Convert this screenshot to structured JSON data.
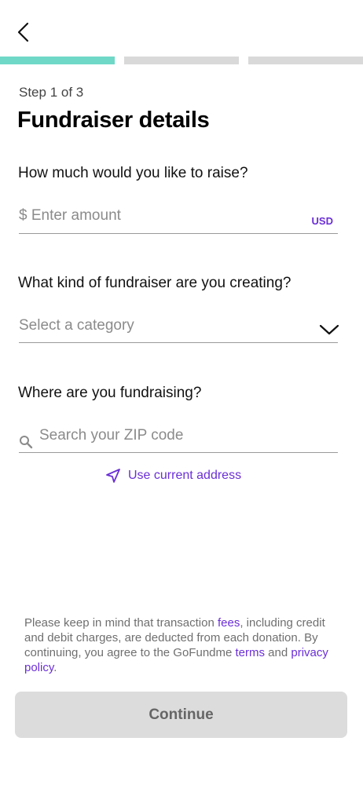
{
  "header": {
    "back_icon": "chevron-left-icon"
  },
  "progress": {
    "total_steps": 3,
    "current_step": 1,
    "active_color": "#6fd8c7",
    "inactive_color": "#d9d9d9"
  },
  "step_label": "Step 1 of 3",
  "title": "Fundraiser details",
  "amount": {
    "question": "How much would you like to raise?",
    "placeholder": "$ Enter amount",
    "currency": "USD"
  },
  "category": {
    "question": "What kind of fundraiser are you creating?",
    "placeholder": "Select a category",
    "icon": "chevron-down-icon"
  },
  "location": {
    "question": "Where are you fundraising?",
    "placeholder": "Search your ZIP code",
    "search_icon": "search-icon",
    "use_current_label": "Use current address",
    "use_current_icon": "navigation-arrow-icon"
  },
  "disclaimer": {
    "part1": "Please keep in mind that transaction ",
    "fees_link": "fees",
    "part2": ", including credit and debit charges, are deducted from each donation. By continuing, you agree to the GoFundme ",
    "terms_link": "terms",
    "part3": " and ",
    "privacy_link": "privacy policy",
    "part4": "."
  },
  "continue_label": "Continue",
  "colors": {
    "accent": "#6b2fd6",
    "button_bg": "#dcdcdc",
    "button_text": "#666666"
  }
}
